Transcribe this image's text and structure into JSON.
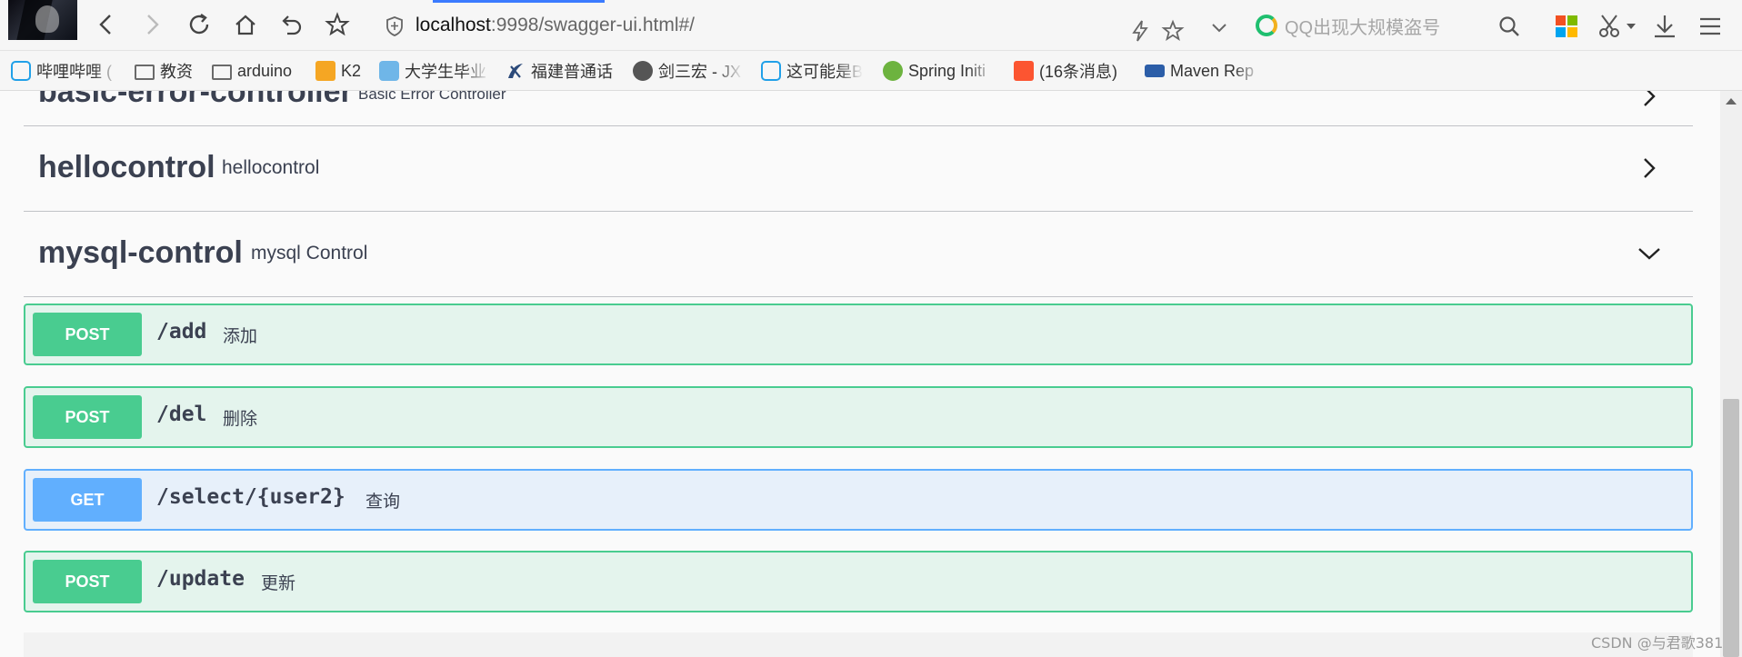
{
  "browser": {
    "url_host": "localhost",
    "url_rest": ":9998/swagger-ui.html#/",
    "search_placeholder": "QQ出现大规模盗号",
    "icons": [
      "back-icon",
      "forward-icon",
      "reload-icon",
      "home-icon",
      "undo-icon",
      "star-icon",
      "shield-icon",
      "lightning-icon",
      "bookmark-star-icon",
      "dropdown-icon",
      "search-icon",
      "apps-icon",
      "scissors-icon",
      "download-icon",
      "menu-icon"
    ]
  },
  "bookmarks": [
    {
      "label": "哔哩哔哩 (",
      "icon": "bilibili"
    },
    {
      "label": "教资",
      "icon": "folder"
    },
    {
      "label": "arduino",
      "icon": "folder"
    },
    {
      "label": "K2",
      "icon": "k2"
    },
    {
      "label": "大学生毕业",
      "icon": "edu"
    },
    {
      "label": "福建普通话",
      "icon": "fj"
    },
    {
      "label": "剑三宏 - JX",
      "icon": "jx"
    },
    {
      "label": "这可能是B",
      "icon": "bilibili"
    },
    {
      "label": "Spring Initi",
      "icon": "spring"
    },
    {
      "label": "(16条消息)",
      "icon": "csdn"
    },
    {
      "label": "Maven Rep",
      "icon": "mvn"
    }
  ],
  "swagger": {
    "sections": [
      {
        "name": "basic-error-controller",
        "desc": "Basic Error Controller",
        "expanded": false
      },
      {
        "name": "hellocontrol",
        "desc": "hellocontrol",
        "expanded": false
      },
      {
        "name": "mysql-control",
        "desc": "mysql Control",
        "expanded": true
      }
    ],
    "operations": [
      {
        "method": "POST",
        "path": "/add",
        "summary": "添加"
      },
      {
        "method": "POST",
        "path": "/del",
        "summary": "删除"
      },
      {
        "method": "GET",
        "path": "/select/{user2}",
        "summary": "查询"
      },
      {
        "method": "POST",
        "path": "/update",
        "summary": "更新"
      }
    ]
  },
  "watermark": "CSDN @与君歌381",
  "colors": {
    "post": "#49cc90",
    "get": "#61affe",
    "text": "#3b4151",
    "tab_indicator": "#3b7bff"
  }
}
